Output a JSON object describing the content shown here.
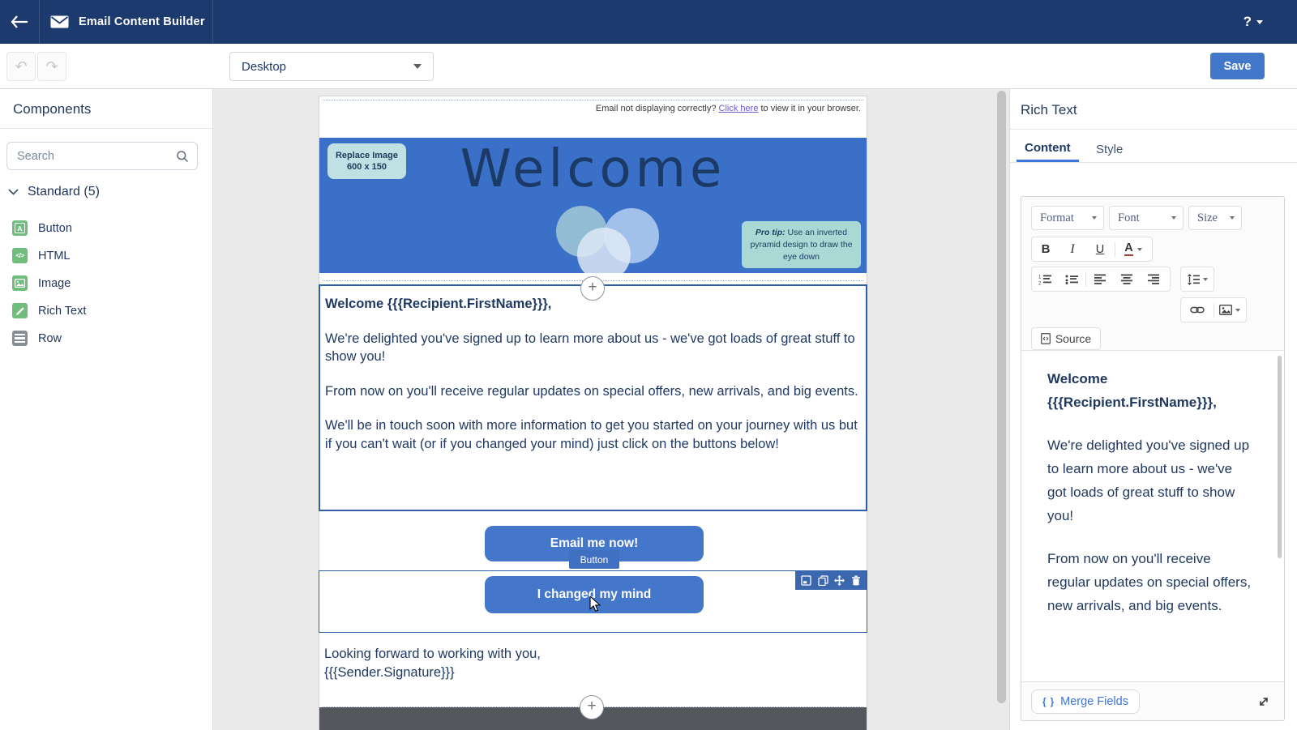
{
  "navbar": {
    "title": "Email Content Builder",
    "help": "?"
  },
  "toolbar": {
    "view_mode": "Desktop",
    "save": "Save"
  },
  "sidebar": {
    "title": "Components",
    "search_placeholder": "Search",
    "section_label": "Standard (5)",
    "items": [
      {
        "label": "Button"
      },
      {
        "label": "HTML"
      },
      {
        "label": "Image"
      },
      {
        "label": "Rich Text"
      },
      {
        "label": "Row"
      }
    ]
  },
  "canvas": {
    "notice": {
      "prefix": "Email not displaying correctly? ",
      "link": "Click here",
      "suffix": " to view it in your browser."
    },
    "banner": {
      "replace_line1": "Replace Image",
      "replace_line2": "600 x 150",
      "headline": "Welcome",
      "pro_tip_label": "Pro tip:",
      "pro_tip_text": " Use an inverted pyramid design to draw the eye down"
    },
    "rich_text": {
      "paragraphs": [
        "Welcome {{{Recipient.FirstName}}},",
        "We're delighted you've signed up to learn more about us - we've got loads of great stuff to show you!",
        "From now on you'll receive regular updates on special offers, new arrivals, and big events.",
        "We'll be in touch soon with more information to get you started on your journey with us but if you can't wait (or if you changed your mind) just click on the buttons below!"
      ]
    },
    "buttons": {
      "primary": "Email me now!",
      "component_tag": "Button",
      "secondary": "I changed my mind"
    },
    "closing": [
      "Looking forward to working with you,",
      "{{{Sender.Signature}}}"
    ]
  },
  "panel": {
    "title": "Rich Text",
    "tabs": [
      "Content",
      "Style"
    ],
    "editor": {
      "format_label": "Format",
      "font_label": "Font",
      "size_label": "Size",
      "bold": "B",
      "italic": "I",
      "underline": "U",
      "color": "A",
      "source_label": "Source",
      "paragraphs": [
        "Welcome {{{Recipient.FirstName}}},",
        "We're delighted you've signed up to learn more about us - we've got loads of great stuff to show you!",
        "From now on you'll receive regular updates on special offers, new arrivals, and big events."
      ]
    },
    "merge_fields_label": "Merge Fields"
  },
  "colors": {
    "navbar_navy": "#1d3a6e",
    "accent_blue": "#4477ca",
    "banner_blue": "#3b70c8",
    "selection_blue": "#2e5fa9",
    "component_green": "#6fbe7d",
    "replace_badge_mint": "#bfe1e3",
    "protip_badge_mint": "#a9d8d5",
    "footer_gray": "#54575c",
    "link_purple": "#6a5acd",
    "tab_blue": "#3b74dd",
    "text_navy": "#21395f"
  }
}
